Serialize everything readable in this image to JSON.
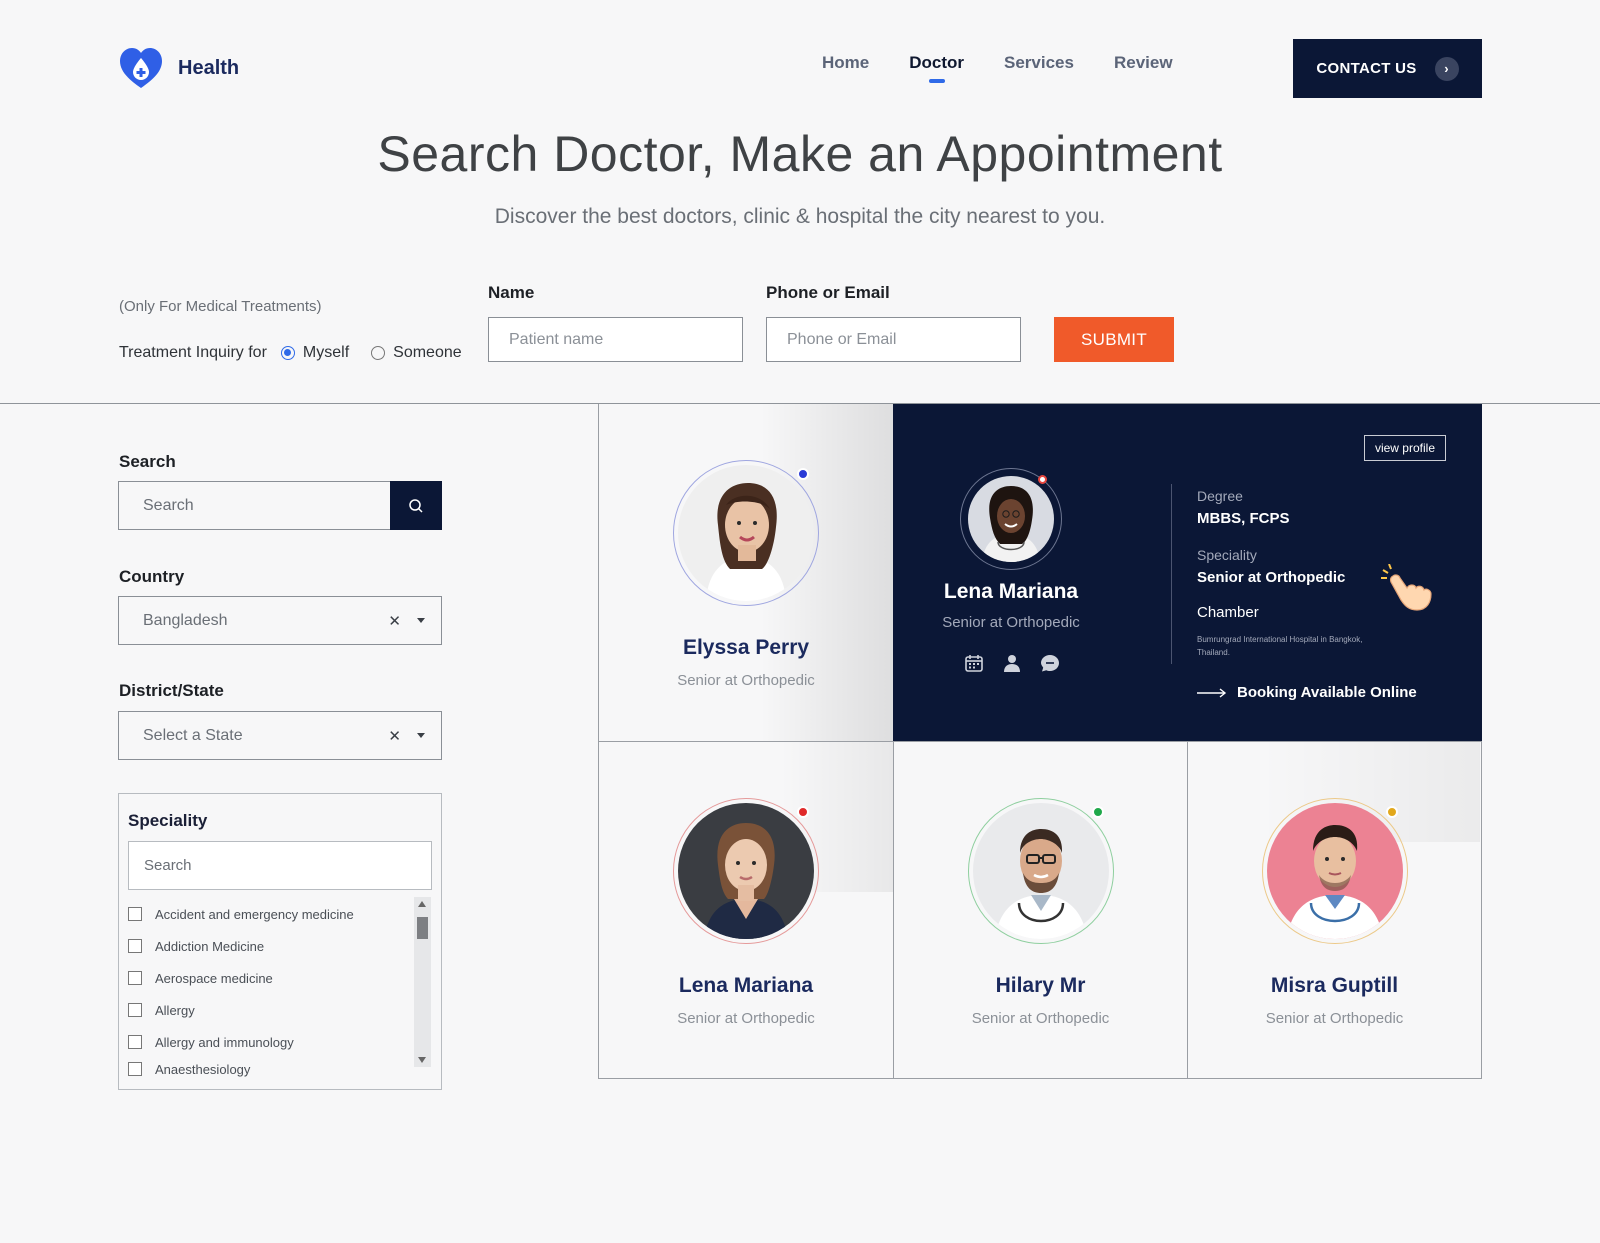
{
  "brand": {
    "name": "Health",
    "color": "#2f5fe6"
  },
  "nav": {
    "items": [
      "Home",
      "Doctor",
      "Services",
      "Review"
    ],
    "active": "Doctor",
    "contact_label": "CONTACT US"
  },
  "hero": {
    "title": "Search Doctor, Make an Appointment",
    "subtitle": "Discover the best doctors, clinic & hospital the city nearest to you."
  },
  "inquiry": {
    "note": "(Only For Medical Treatments)",
    "label": "Treatment Inquiry for",
    "options": [
      "Myself",
      "Someone"
    ],
    "selected": "Myself",
    "name_label": "Name",
    "name_placeholder": "Patient name",
    "contact_label": "Phone or Email",
    "contact_placeholder": "Phone or Email",
    "submit_label": "SUBMIT"
  },
  "filters": {
    "search_label": "Search",
    "search_placeholder": "Search",
    "country_label": "Country",
    "country_value": "Bangladesh",
    "state_label": "District/State",
    "state_value": "Select a State",
    "speciality_label": "Speciality",
    "speciality_search_placeholder": "Search",
    "specialities": [
      "Accident and emergency medicine",
      "Addiction Medicine",
      "Aerospace medicine",
      "Allergy",
      "Allergy and immunology",
      "Anaesthesiology"
    ]
  },
  "doctors": [
    {
      "name": "Elyssa Perry",
      "role": "Senior at Orthopedic",
      "status_color": "#2a3bd6",
      "ring_color": "#9fa6e0"
    },
    {
      "name": "Lena Mariana",
      "role": "Senior at Orthopedic",
      "status_color": "#e02a2a",
      "ring_color": "#e59a9a"
    },
    {
      "name": "Hilary Mr",
      "role": "Senior at Orthopedic",
      "status_color": "#1fa84a",
      "ring_color": "#8fcf9f"
    },
    {
      "name": "Misra Guptill",
      "role": "Senior at Orthopedic",
      "status_color": "#e2a81c",
      "ring_color": "#ecc989"
    }
  ],
  "featured": {
    "name": "Lena Mariana",
    "role": "Senior at Orthopedic",
    "view_profile_label": "view profile",
    "degree_label": "Degree",
    "degree_value": "MBBS, FCPS",
    "speciality_label": "Speciality",
    "speciality_value": "Senior at Orthopedic",
    "chamber_label": "Chamber",
    "chamber_address": "Bumrungrad International Hospital in Bangkok, Thailand.",
    "booking_label": "Booking Available Online"
  },
  "colors": {
    "navy": "#0b1736",
    "accent_orange": "#f05a2a",
    "active_underline": "#2f6ae8"
  }
}
